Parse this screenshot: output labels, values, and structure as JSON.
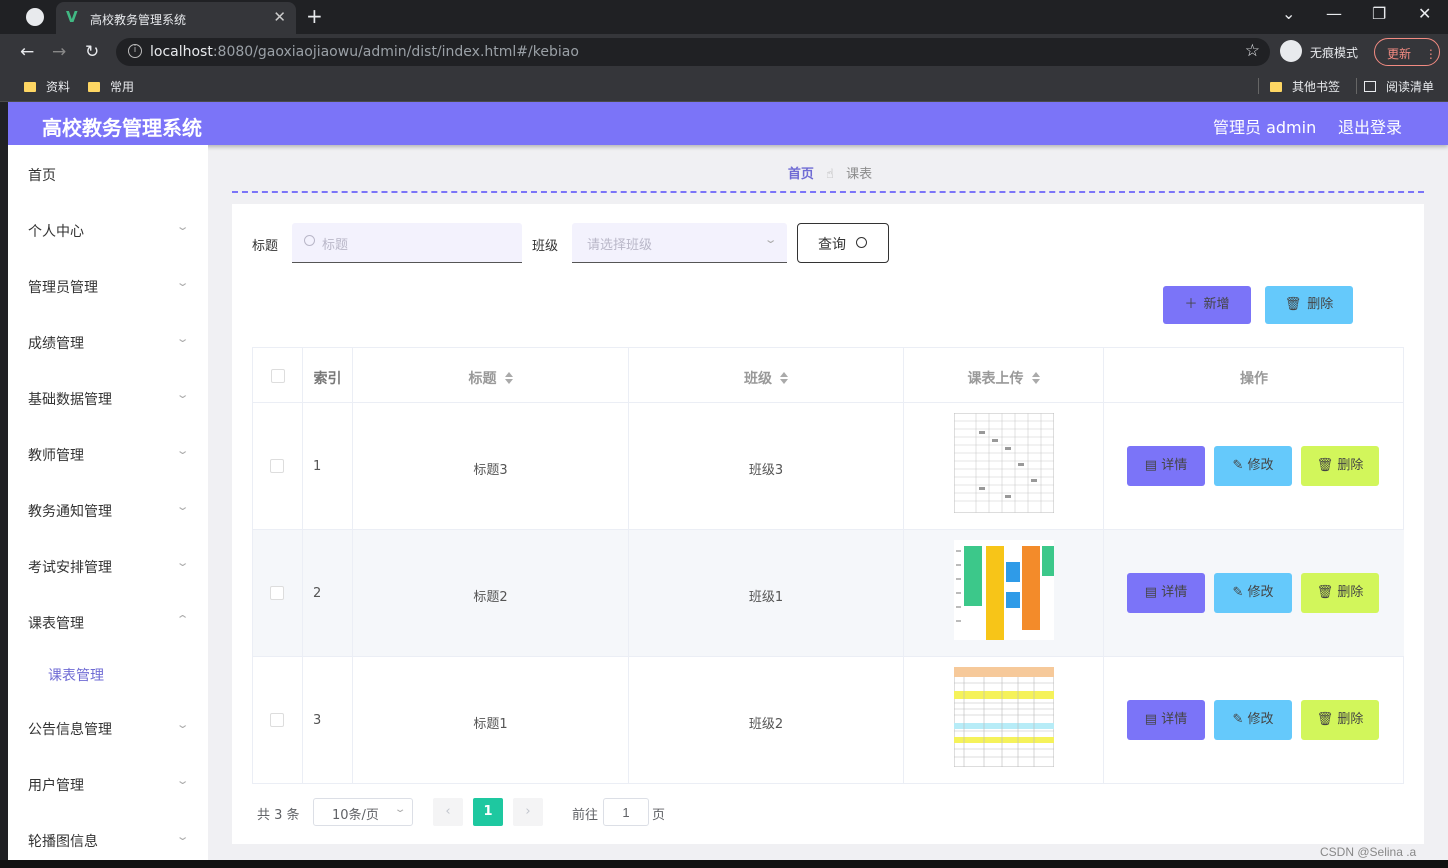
{
  "browser": {
    "tab_title": "高校教务管理系统",
    "url_host": "localhost",
    "url_rest": ":8080/gaoxiaojiaowu/admin/dist/index.html#/kebiao",
    "incognito_label": "无痕模式",
    "update_label": "更新",
    "bookmarks": [
      "资料",
      "常用"
    ],
    "bookmarks_right": [
      "其他书签",
      "阅读清单"
    ]
  },
  "header": {
    "brand": "高校教务管理系统",
    "user": "管理员 admin",
    "logout": "退出登录",
    "color": "#7b74f8"
  },
  "sidebar": {
    "items": [
      {
        "label": "首页",
        "has_children": false
      },
      {
        "label": "个人中心",
        "has_children": true
      },
      {
        "label": "管理员管理",
        "has_children": true
      },
      {
        "label": "成绩管理",
        "has_children": true
      },
      {
        "label": "基础数据管理",
        "has_children": true
      },
      {
        "label": "教师管理",
        "has_children": true
      },
      {
        "label": "教务通知管理",
        "has_children": true
      },
      {
        "label": "考试安排管理",
        "has_children": true
      },
      {
        "label": "课表管理",
        "has_children": true,
        "expanded": true
      },
      {
        "label": "公告信息管理",
        "has_children": true
      },
      {
        "label": "用户管理",
        "has_children": true
      },
      {
        "label": "轮播图信息",
        "has_children": true
      }
    ],
    "active_sub": "课表管理"
  },
  "breadcrumb": {
    "home": "首页",
    "current": "课表"
  },
  "search": {
    "title_label": "标题",
    "title_placeholder": "标题",
    "class_label": "班级",
    "class_placeholder": "请选择班级",
    "query_button": "查询"
  },
  "toolbar": {
    "add": "新增",
    "delete": "删除"
  },
  "table": {
    "columns": [
      "索引",
      "标题",
      "班级",
      "课表上传",
      "操作"
    ],
    "rows": [
      {
        "index": "1",
        "title": "标题3",
        "class": "班级3",
        "image": "timetable-grid"
      },
      {
        "index": "2",
        "title": "标题2",
        "class": "班级1",
        "image": "timetable-color"
      },
      {
        "index": "3",
        "title": "标题1",
        "class": "班级2",
        "image": "timetable-form"
      }
    ],
    "actions": {
      "detail": "详情",
      "edit": "修改",
      "delete": "删除"
    }
  },
  "pager": {
    "total": "共 3 条",
    "page_size": "10条/页",
    "current": "1",
    "goto": "前往",
    "goto_value": "1",
    "unit": "页"
  },
  "watermark": "CSDN @Selina .a",
  "colors": {
    "primary": "#7b74f8",
    "info": "#65c9fb",
    "danger": "#d2f65b",
    "page": "#1ec8a0"
  }
}
